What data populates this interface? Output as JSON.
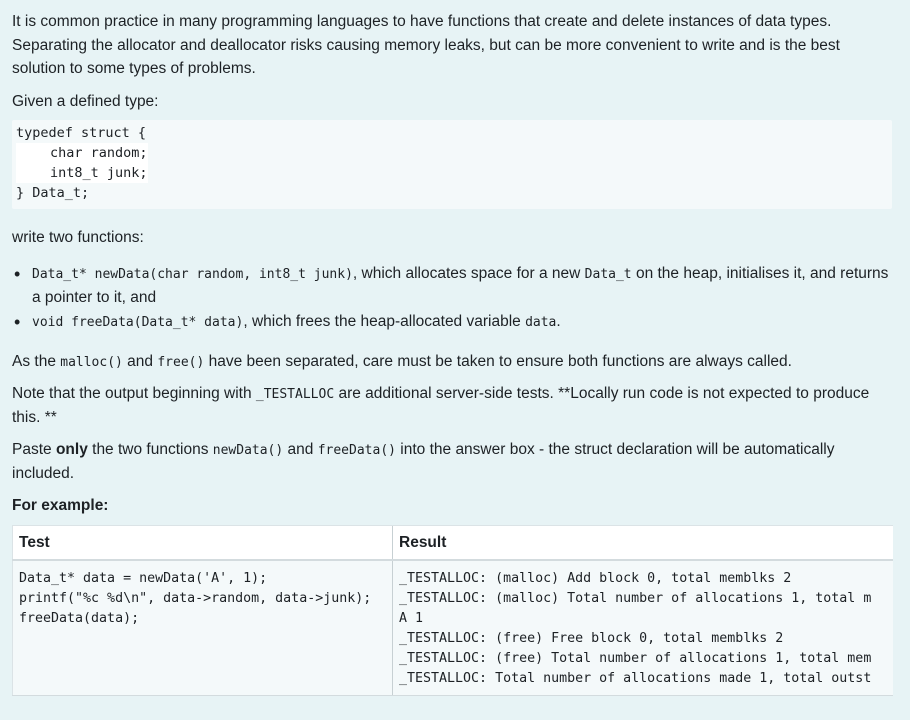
{
  "intro": {
    "text": "It is common practice in many programming languages to have functions that create and delete instances of data types. Separating the allocator and deallocator risks causing memory leaks, but can be more convenient to write and is the best solution to some types of problems.",
    "given": "Given a defined type:"
  },
  "codeblock": {
    "lines": [
      "typedef struct {",
      "char random;",
      "int8_t junk;",
      "} Data_t;"
    ]
  },
  "task": {
    "intro": "write two functions:",
    "item1_code": "Data_t* newData(char random, int8_t junk)",
    "item1_mid": ", which allocates space for a new ",
    "item1_code2": "Data_t",
    "item1_end": " on the heap, initialises it, and returns a pointer to it, and",
    "item2_code": "void freeData(Data_t* data)",
    "item2_mid": ", which frees the heap-allocated variable ",
    "item2_code2": "data",
    "item2_end": "."
  },
  "notes": {
    "n1_a": "As the ",
    "n1_code1": "malloc()",
    "n1_b": " and ",
    "n1_code2": "free()",
    "n1_c": " have been separated, care must be taken to ensure both functions are always called.",
    "n2_a": "Note that the output beginning with ",
    "n2_code": "_TESTALLOC",
    "n2_b": " are additional server-side tests. **Locally run code is not expected to produce this. **",
    "n3_a": "Paste ",
    "n3_bold": "only",
    "n3_b": " the two functions ",
    "n3_code1": "newData()",
    "n3_c": " and ",
    "n3_code2": "freeData()",
    "n3_d": " into the answer box - the struct declaration will be automatically included."
  },
  "example": {
    "title": "For example:",
    "headers": [
      "Test",
      "Result"
    ],
    "test": "Data_t* data = newData('A', 1);\nprintf(\"%c %d\\n\", data->random, data->junk);\nfreeData(data);",
    "result": "_TESTALLOC: (malloc) Add block 0, total memblks 2\n_TESTALLOC: (malloc) Total number of allocations 1, total m\nA 1\n_TESTALLOC: (free) Free block 0, total memblks 2\n_TESTALLOC: (free) Total number of allocations 1, total mem\n_TESTALLOC: Total number of allocations made 1, total outst"
  }
}
